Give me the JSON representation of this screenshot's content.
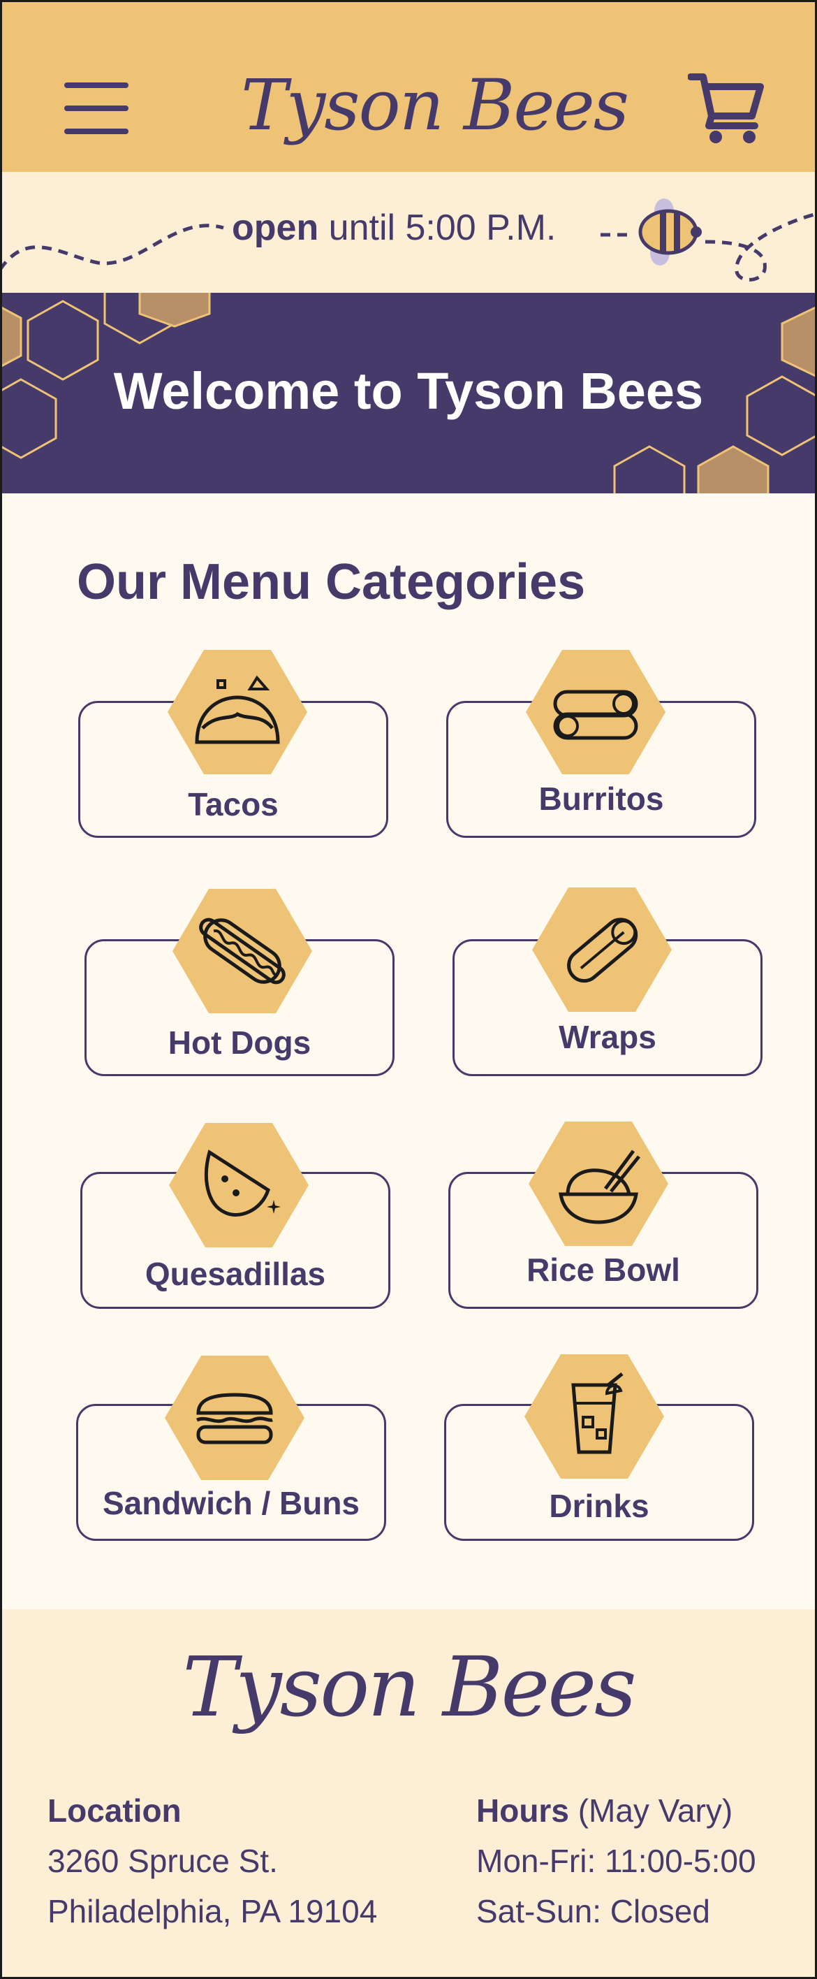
{
  "header": {
    "brand": "Tyson Bees",
    "menu_icon": "hamburger-menu-icon",
    "cart_icon": "shopping-cart-icon"
  },
  "status": {
    "open_word": "open",
    "until_text": "until 5:00 P.M.",
    "bee_icon": "bee-icon"
  },
  "welcome": {
    "title": "Welcome to Tyson Bees"
  },
  "menu": {
    "title": "Our Menu Categories",
    "categories": [
      {
        "label": "Tacos",
        "icon": "taco-icon"
      },
      {
        "label": "Burritos",
        "icon": "burrito-icon"
      },
      {
        "label": "Hot Dogs",
        "icon": "hot-dog-icon"
      },
      {
        "label": "Wraps",
        "icon": "wrap-icon"
      },
      {
        "label": "Quesadillas",
        "icon": "quesadilla-icon"
      },
      {
        "label": "Rice Bowl",
        "icon": "rice-bowl-icon"
      },
      {
        "label": "Sandwich / Buns",
        "icon": "sandwich-icon"
      },
      {
        "label": "Drinks",
        "icon": "drink-icon"
      }
    ]
  },
  "footer": {
    "brand": "Tyson Bees",
    "location_heading": "Location",
    "address_line1": "3260 Spruce St.",
    "address_line2": "Philadelphia, PA 19104",
    "hours_heading": "Hours",
    "hours_note": "(May Vary)",
    "hours_weekday": "Mon-Fri: 11:00-5:00",
    "hours_weekend": "Sat-Sun: Closed"
  },
  "colors": {
    "primary": "#463a6b",
    "honey": "#efc375",
    "cream": "#fdeed6",
    "background": "#fffaf0"
  }
}
